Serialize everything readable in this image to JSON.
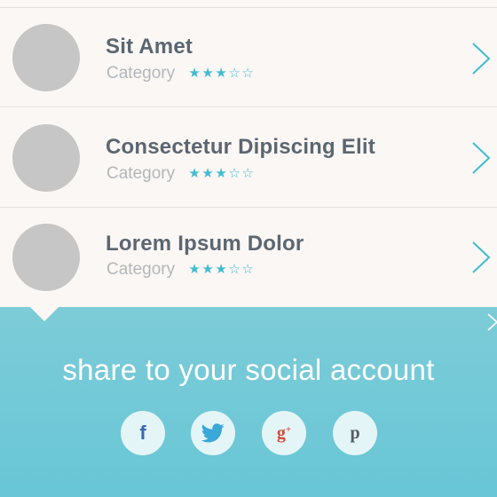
{
  "list": {
    "items": [
      {
        "title": "Sit Amet",
        "category": "Category",
        "rating": 3,
        "max_rating": 5
      },
      {
        "title": "Consectetur Dipiscing Elit",
        "category": "Category",
        "rating": 3,
        "max_rating": 5
      },
      {
        "title": "Lorem Ipsum Dolor",
        "category": "Category",
        "rating": 3,
        "max_rating": 5
      }
    ]
  },
  "share": {
    "title": "share to your social account",
    "buttons": [
      {
        "name": "facebook",
        "glyph": "f",
        "icon": "facebook-icon"
      },
      {
        "name": "twitter",
        "glyph": "",
        "icon": "twitter-icon"
      },
      {
        "name": "google-plus",
        "glyph": "g",
        "icon": "google-plus-icon"
      },
      {
        "name": "pinterest",
        "glyph": "p",
        "icon": "pinterest-icon"
      }
    ]
  },
  "colors": {
    "accent": "#3fbcd0",
    "title_text": "#5b6672",
    "category_text": "#b3b7bb",
    "row_bg": "#fbf7f4",
    "share_bg": "#7dccd8",
    "avatar": "#c6c6c6"
  }
}
